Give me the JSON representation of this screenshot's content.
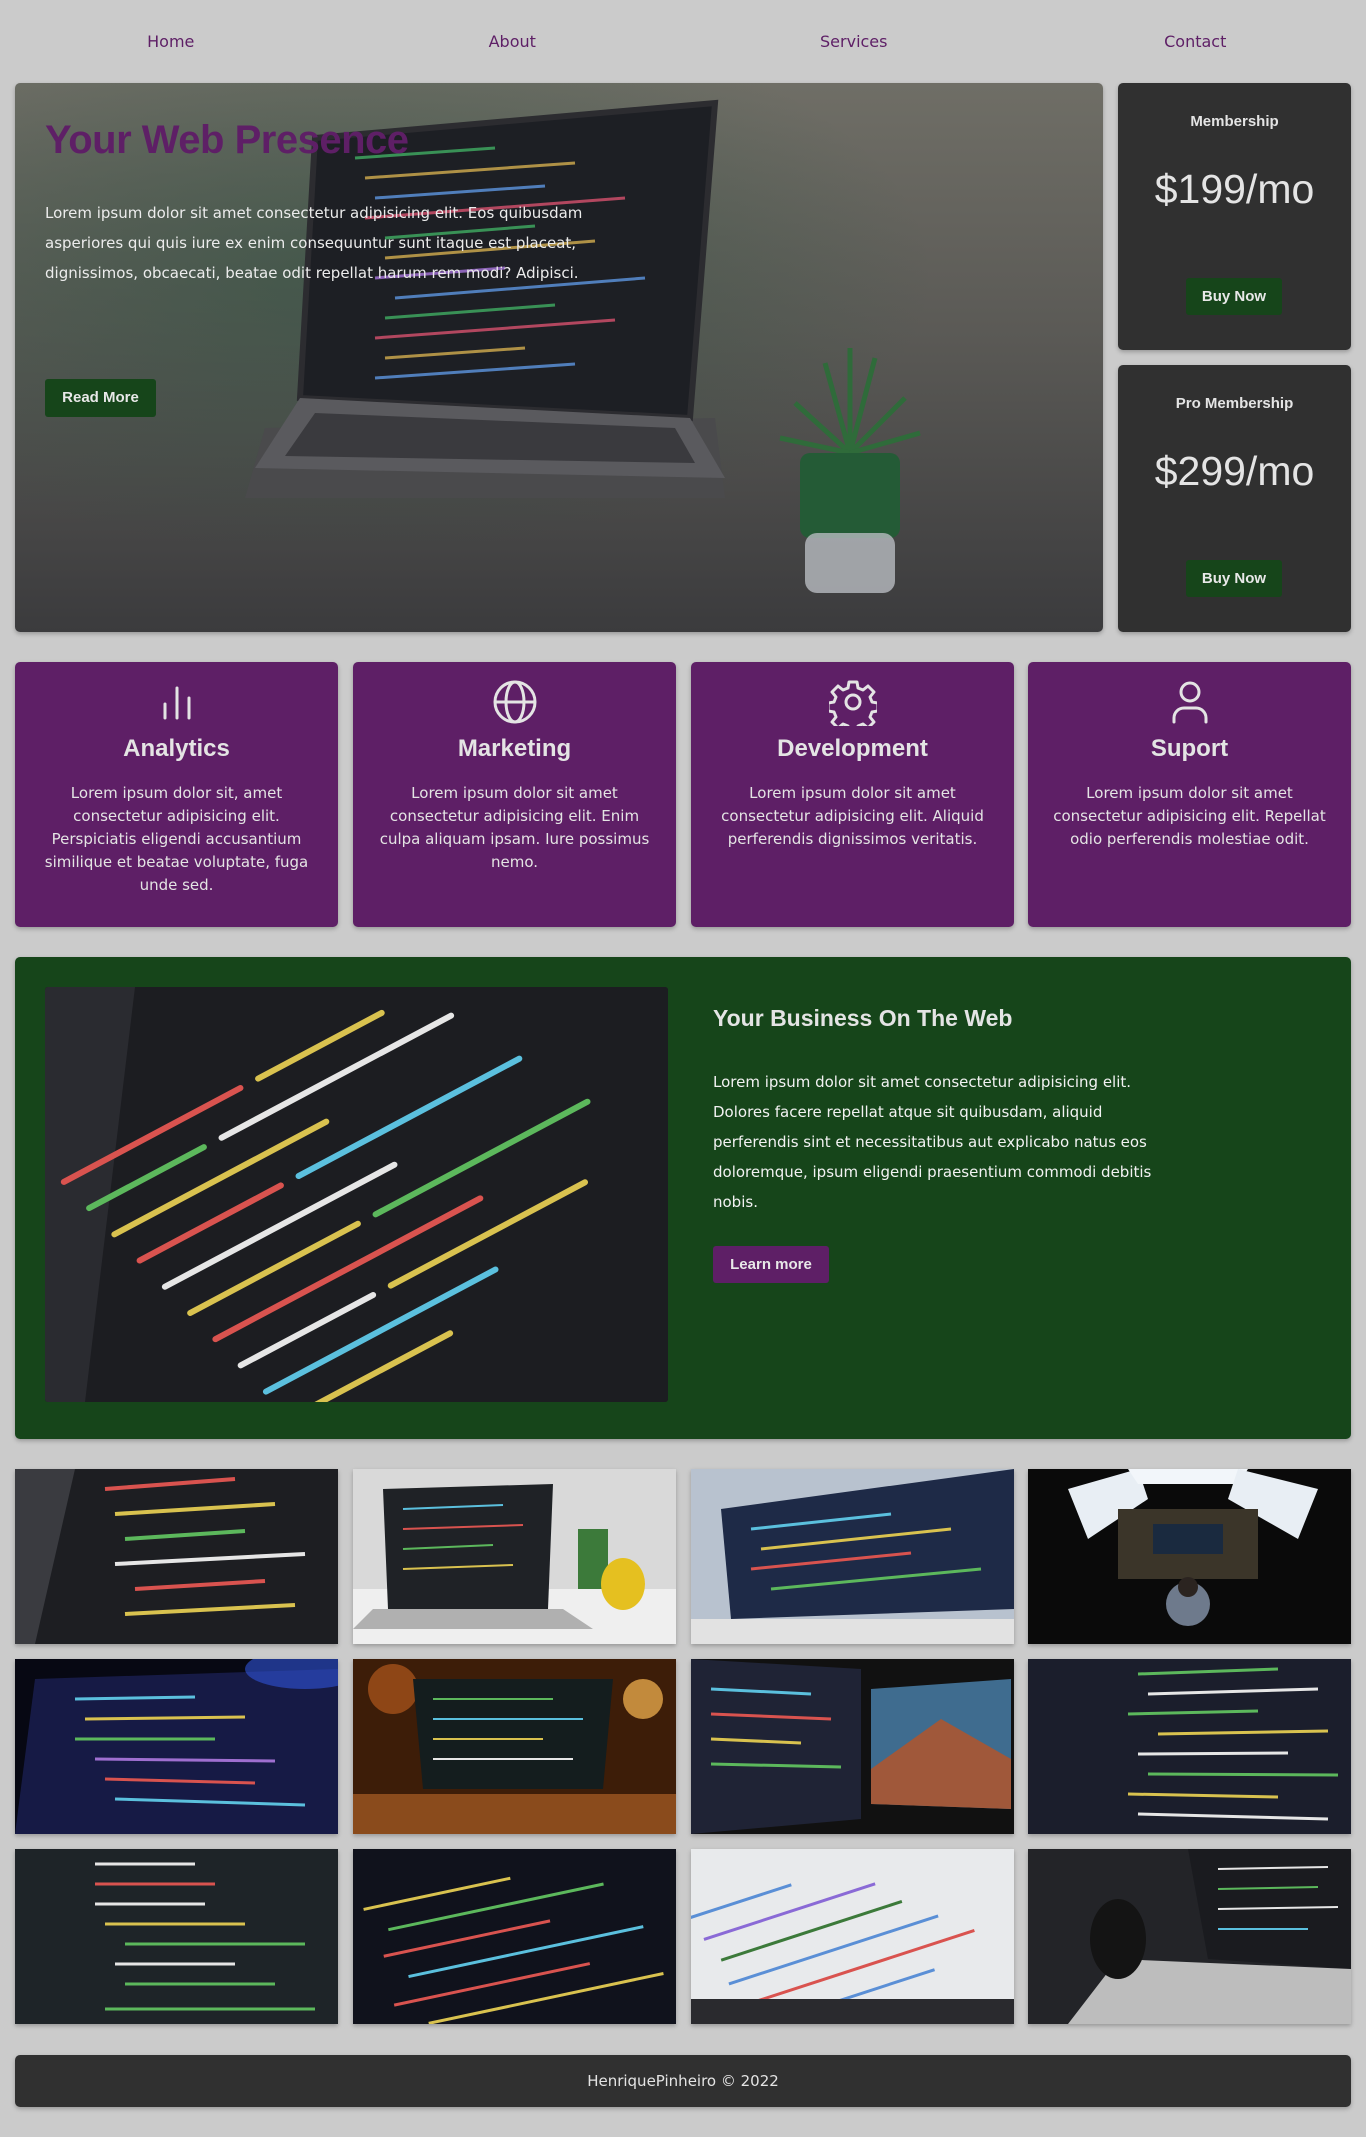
{
  "nav": {
    "items": [
      {
        "label": "Home"
      },
      {
        "label": "About"
      },
      {
        "label": "Services"
      },
      {
        "label": "Contact"
      }
    ]
  },
  "hero": {
    "title": "Your Web Presence",
    "text": "Lorem ipsum dolor sit amet consectetur adipisicing elit. Eos quibusdam asperiores qui quis iure ex enim consequuntur sunt itaque est placeat, dignissimos, obcaecati, beatae odit repellat harum rem modi? Adipisci.",
    "button_label": "Read More"
  },
  "pricing": [
    {
      "name": "Membership",
      "price": "$199/mo",
      "button_label": "Buy Now"
    },
    {
      "name": "Pro Membership",
      "price": "$299/mo",
      "button_label": "Buy Now"
    }
  ],
  "features": [
    {
      "icon": "bar-chart-icon",
      "title": "Analytics",
      "text": "Lorem ipsum dolor sit, amet consectetur adipisicing elit. Perspiciatis eligendi accusantium similique et beatae voluptate, fuga unde sed."
    },
    {
      "icon": "globe-icon",
      "title": "Marketing",
      "text": "Lorem ipsum dolor sit amet consectetur adipisicing elit. Enim culpa aliquam ipsam. Iure possimus nemo."
    },
    {
      "icon": "gear-icon",
      "title": "Development",
      "text": "Lorem ipsum dolor sit amet consectetur adipisicing elit. Aliquid perferendis dignissimos veritatis."
    },
    {
      "icon": "user-icon",
      "title": "Suport",
      "text": "Lorem ipsum dolor sit amet consectetur adipisicing elit. Repellat odio perferendis molestiae odit."
    }
  ],
  "business": {
    "title": "Your Business On The Web",
    "text": "Lorem ipsum dolor sit amet consectetur adipisicing elit. Dolores facere repellat atque sit quibusdam, aliquid perferendis sint et necessitatibus aut explicabo natus eos doloremque, ipsum eligendi praesentium commodi debitis nobis.",
    "button_label": "Learn more"
  },
  "footer": {
    "text": "HenriquePinheiro © 2022"
  },
  "colors": {
    "background": "#cbcbcb",
    "brand_purple": "#5e1f66",
    "brand_green": "#16451a",
    "dark_card": "#303030"
  }
}
